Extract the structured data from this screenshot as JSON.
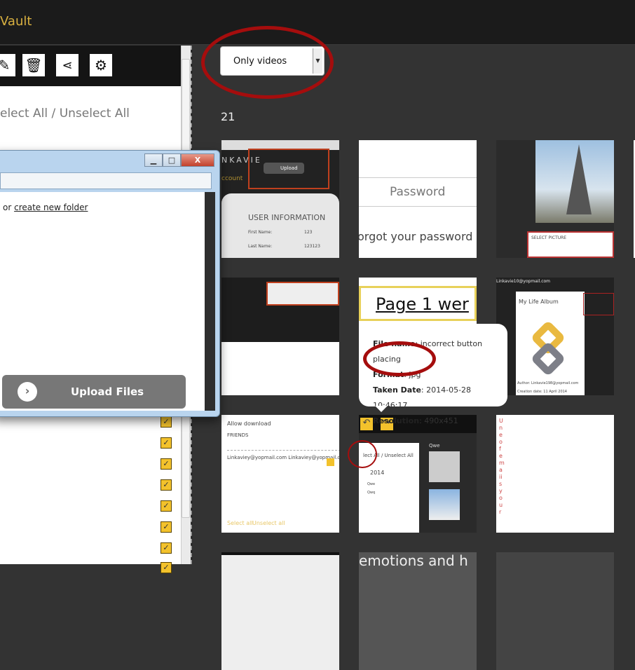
{
  "header": {
    "title": "Vault"
  },
  "toolbar": {
    "icons": [
      "edit-icon",
      "trash-icon",
      "share-icon",
      "settings-icon"
    ]
  },
  "left": {
    "select_all": "elect All",
    "sep": " / ",
    "unselect_all": "Unselect All"
  },
  "filter": {
    "selected": "Only videos"
  },
  "gallery": {
    "count": "21"
  },
  "dialog": {
    "or_text": "or ",
    "create_folder": "create new folder",
    "upload_label": "Upload Files",
    "min": "▁",
    "max": "□",
    "close": "X"
  },
  "tooltip": {
    "file_label": "File name",
    "file_value": "incorrect button placing",
    "format_label": "Format",
    "format_value": "jpg",
    "date_label": "Taken Date",
    "date_value": "2014-05-28 10:46:17",
    "res_label": "Resolution",
    "res_value": "490x451"
  },
  "tiles": {
    "t1": {
      "brand": "NKAVIE",
      "upload": "Upload",
      "account": "ccount",
      "heading": "USER INFORMATION",
      "first": "First Name:",
      "first_v": "123",
      "last": "Last Name:",
      "last_v": "123123"
    },
    "t2": {
      "password": "Password",
      "forgot": "orgot your password"
    },
    "t3": {
      "select": "SELECT PICTURE"
    },
    "t5": {
      "text": "Page 1 wer"
    },
    "t6": {
      "header": "Linkavie10@yopmail.com",
      "title": "My Life Album",
      "author": "Author: Linkavie198@yopmail.com",
      "created": "Creation date: 11 April 2014"
    },
    "t7": {
      "allow": "Allow download",
      "friends": "FRIENDS",
      "email": "Linkaviey@yopmail.com Linkaviey@yopmail.com",
      "selall": "Select all",
      "unselall": "Unselect all"
    },
    "t8": {
      "selall": "lect All / Unselect All",
      "year": "2014",
      "a": "Qwe",
      "b": "Qwq",
      "album": "Qwe"
    },
    "t9": {
      "letters": "Uneofemaiisyour"
    },
    "t11": {
      "text": "emotions and h"
    }
  }
}
